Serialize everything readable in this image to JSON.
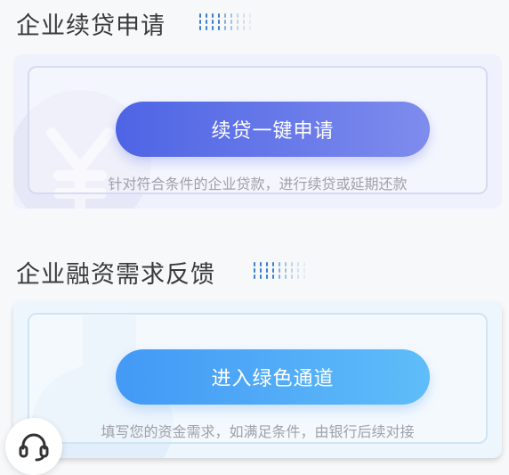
{
  "section1": {
    "title": "企业续贷申请",
    "button_label": "续贷一键申请",
    "description": "针对符合条件的企业贷款，进行续贷或延期还款"
  },
  "section2": {
    "title": "企业融资需求反馈",
    "button_label": "进入绿色通道",
    "description": "填写您的资金需求，如满足条件，由银行后续对接"
  },
  "icons": {
    "section1_watermark": "yen-icon",
    "section2_watermark": "document-icon",
    "support": "headset-icon"
  },
  "colors": {
    "title_text": "#3a3a3a",
    "section1_button": "#4e64e4",
    "section2_button": "#4399f5",
    "description_text": "#a0a0a8"
  }
}
